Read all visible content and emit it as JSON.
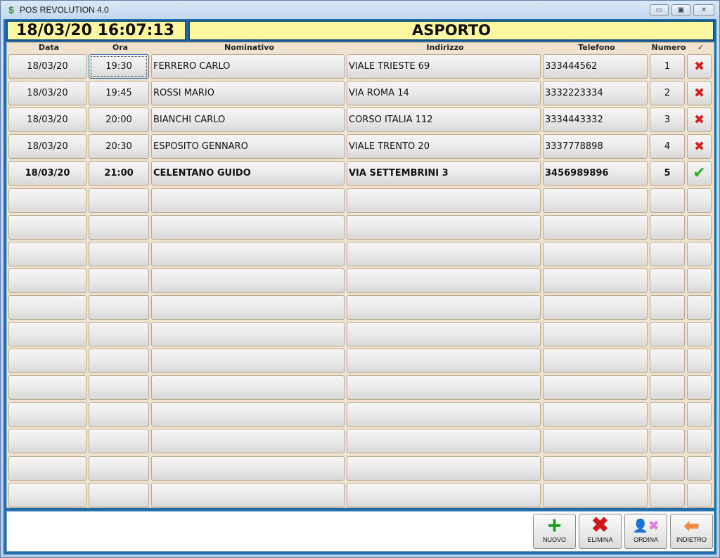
{
  "window": {
    "title": "POS REVOLUTION 4.0",
    "app_icon": "dollar-icon",
    "controls": [
      "minimize-icon",
      "restore-icon",
      "close-icon"
    ]
  },
  "header": {
    "datetime": "18/03/20 16:07:13",
    "mode": "ASPORTO"
  },
  "columns": {
    "data": "Data",
    "ora": "Ora",
    "nominativo": "Nominativo",
    "indirizzo": "Indirizzo",
    "telefono": "Telefono",
    "numero": "Numero",
    "check": "✓"
  },
  "rows": [
    {
      "data": "18/03/20",
      "ora": "19:30",
      "nominativo": "FERRERO CARLO",
      "indirizzo": "VIALE TRIESTE 69",
      "telefono": "333444562",
      "numero": "1",
      "status": "x",
      "status_icon": "red-x-icon"
    },
    {
      "data": "18/03/20",
      "ora": "19:45",
      "nominativo": "ROSSI MARIO",
      "indirizzo": "VIA ROMA 14",
      "telefono": "3332223334",
      "numero": "2",
      "status": "x",
      "status_icon": "red-x-icon"
    },
    {
      "data": "18/03/20",
      "ora": "20:00",
      "nominativo": "BIANCHI CARLO",
      "indirizzo": "CORSO ITALIA 112",
      "telefono": "3334443332",
      "numero": "3",
      "status": "x",
      "status_icon": "red-x-icon"
    },
    {
      "data": "18/03/20",
      "ora": "20:30",
      "nominativo": "ESPOSITO GENNARO",
      "indirizzo": "VIALE TRENTO 20",
      "telefono": "3337778898",
      "numero": "4",
      "status": "x",
      "status_icon": "red-x-icon"
    },
    {
      "data": "18/03/20",
      "ora": "21:00",
      "nominativo": "CELENTANO GUIDO",
      "indirizzo": "VIA SETTEMBRINI 3",
      "telefono": "3456989896",
      "numero": "5",
      "status": "ok",
      "status_icon": "green-check-icon"
    }
  ],
  "toolbar": {
    "nuovo": "NUOVO",
    "elimina": "ELIMINA",
    "ordina": "ORDINA",
    "indietro": "INDIETRO"
  },
  "colors": {
    "header_bg": "#fdf7a1",
    "frame": "#1f6fae",
    "grid_bg": "#efe3cf",
    "cancel_mark": "#d62020",
    "done_mark": "#23b423"
  }
}
